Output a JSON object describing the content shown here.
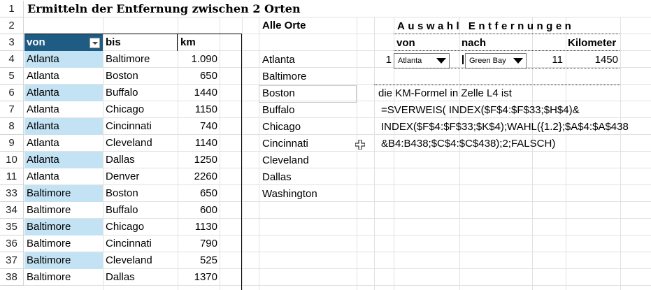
{
  "title": "Ermitteln der Entfernung zwischen 2 Orten",
  "row_numbers": [
    "1",
    "2",
    "3",
    "4",
    "5",
    "6",
    "7",
    "8",
    "9",
    "10",
    "11",
    "33",
    "34",
    "35",
    "36",
    "37",
    "38"
  ],
  "table": {
    "headers": {
      "von": "von",
      "bis": "bis",
      "km": "km"
    },
    "rows": [
      {
        "von": "Atlanta",
        "bis": "Baltimore",
        "km": "1.090"
      },
      {
        "von": "Atlanta",
        "bis": "Boston",
        "km": "650"
      },
      {
        "von": "Atlanta",
        "bis": "Buffalo",
        "km": "1440"
      },
      {
        "von": "Atlanta",
        "bis": "Chicago",
        "km": "1150"
      },
      {
        "von": "Atlanta",
        "bis": "Cincinnati",
        "km": "740"
      },
      {
        "von": "Atlanta",
        "bis": "Cleveland",
        "km": "1140"
      },
      {
        "von": "Atlanta",
        "bis": "Dallas",
        "km": "1250"
      },
      {
        "von": "Atlanta",
        "bis": "Denver",
        "km": "2260"
      },
      {
        "von": "Baltimore",
        "bis": "Boston",
        "km": "650"
      },
      {
        "von": "Baltimore",
        "bis": "Buffalo",
        "km": "600"
      },
      {
        "von": "Baltimore",
        "bis": "Chicago",
        "km": "1130"
      },
      {
        "von": "Baltimore",
        "bis": "Cincinnati",
        "km": "790"
      },
      {
        "von": "Baltimore",
        "bis": "Cleveland",
        "km": "525"
      },
      {
        "von": "Baltimore",
        "bis": "Dallas",
        "km": "1370"
      }
    ]
  },
  "alle_orte": {
    "header": "Alle Orte",
    "items": [
      "Atlanta",
      "Baltimore",
      "Boston",
      "Buffalo",
      "Chicago",
      "Cincinnati",
      "Cleveland",
      "Dallas",
      "Washington"
    ]
  },
  "auswahl": {
    "header": "Auswahl Entfernungen",
    "von_label": "von",
    "nach_label": "nach",
    "km_label": "Kilometer",
    "von_index": "1",
    "von_selected": "Atlanta",
    "nach_selected": "Green Bay",
    "nach_index": "11",
    "km_value": "1450"
  },
  "note": {
    "line1": "die KM-Formel in Zelle L4 ist",
    "line2": "=SVERWEIS( INDEX($F$4:$F$33;$H$4)&",
    "line3": "INDEX($F$4:$F$33;$K$4);WAHL({1.2};$A$4:$A$438",
    "line4": "&B4:B438;$C$4:$C$438);2;FALSCH)"
  },
  "colors": {
    "header_fill": "#1f5c84",
    "highlight_fill": "#c3e3f4"
  }
}
